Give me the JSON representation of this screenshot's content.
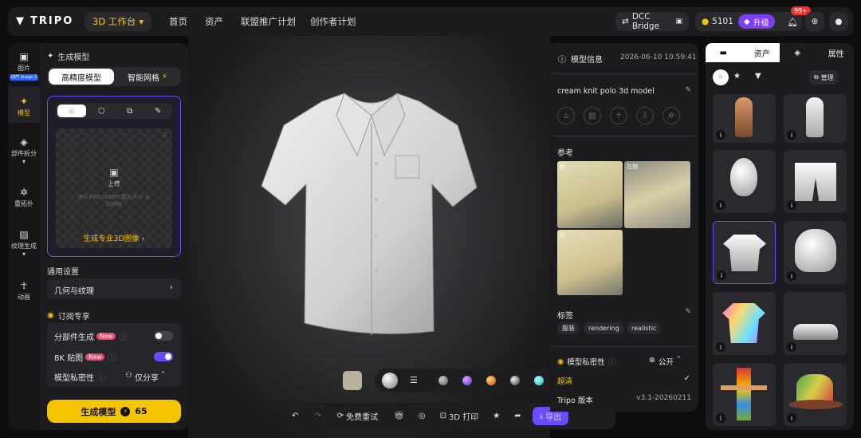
{
  "topbar": {
    "logo": "TRIPO",
    "workspace": "3D 工作台",
    "nav": [
      "首页",
      "资产",
      "联盟推广计划",
      "创作者计划"
    ],
    "dcc": "DCC Bridge",
    "credits": "5101",
    "upgrade": "升级",
    "notif_count": "99+"
  },
  "sidebar": {
    "items": [
      {
        "label": "图片",
        "tag": "GPT Image 2",
        "icon": "image-icon"
      },
      {
        "label": "模型",
        "icon": "sparkle-icon"
      },
      {
        "label": "部件拆分",
        "icon": "cube-split-icon"
      },
      {
        "label": "重拓扑",
        "icon": "mesh-icon"
      },
      {
        "label": "纹理生成",
        "icon": "texture-icon"
      },
      {
        "label": "动画",
        "icon": "figure-icon"
      }
    ]
  },
  "generate": {
    "title": "生成模型",
    "mode_hd": "高精度模型",
    "mode_smart": "智能网格",
    "upload_label": "上传",
    "upload_hint": "JPG,PNG,WEBP 图片大小 ≤ 20MB",
    "pro_image_link": "生成专业3D图像 ›",
    "general_settings": "通用设置",
    "geo_texture": "几何与纹理",
    "subscriber": "订阅专享",
    "part_gen": "分部件生成",
    "new": "New",
    "tex8k": "8K 贴图",
    "privacy": "模型私密性",
    "privacy_value": "仅分享",
    "gen_button": "生成模型",
    "gen_cost": "65"
  },
  "viewer": {
    "free_retry": "免费重试",
    "print3d": "3D 打印",
    "export": "导出"
  },
  "info": {
    "title": "模型信息",
    "date": "2026-06-10 10:59:41",
    "model_name": "cream knit polo 3d model",
    "ref_label": "参考",
    "ref_tags": [
      "前",
      "左侧",
      "后"
    ],
    "tags_label": "标签",
    "tags": [
      "服装",
      "rendering",
      "realistic"
    ],
    "privacy_label": "模型私密性",
    "privacy_value": "公开",
    "quality": "超清",
    "version_label": "Tripo 版本",
    "version": "v3.1-20260211"
  },
  "assets": {
    "tab_assets": "资产",
    "tab_props": "属性",
    "manage": "管理",
    "info_badge": "i"
  }
}
